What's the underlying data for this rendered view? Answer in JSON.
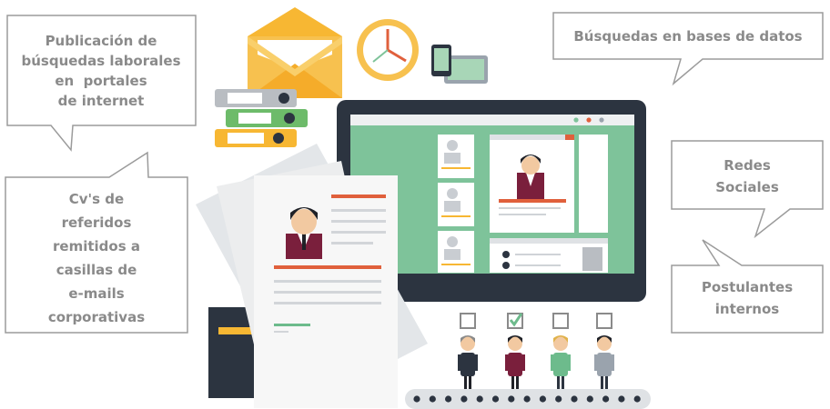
{
  "bubbles": {
    "publicacion": {
      "lines": [
        "Publicación de",
        "búsquedas laborales",
        "en  portales",
        "de internet"
      ]
    },
    "busquedas": {
      "lines": [
        "Búsquedas en bases de datos"
      ]
    },
    "referidos": {
      "lines": [
        "Cv's de",
        "referidos",
        "remitidos a",
        "casillas de",
        "e-mails",
        "corporativas"
      ]
    },
    "redes": {
      "lines": [
        "Redes",
        "Sociales"
      ]
    },
    "postulantes": {
      "lines": [
        "Postulantes",
        "internos"
      ]
    }
  },
  "candidates": [
    {
      "checked": false
    },
    {
      "checked": true
    },
    {
      "checked": false
    },
    {
      "checked": false
    }
  ],
  "colors": {
    "bubble_text": "#8a8a8a",
    "monitor_frame": "#2c3440",
    "screen_green": "#7ec39a",
    "accent_orange": "#e0603c",
    "envelope": "#f7c14f",
    "check_green": "#6dbb8c"
  }
}
